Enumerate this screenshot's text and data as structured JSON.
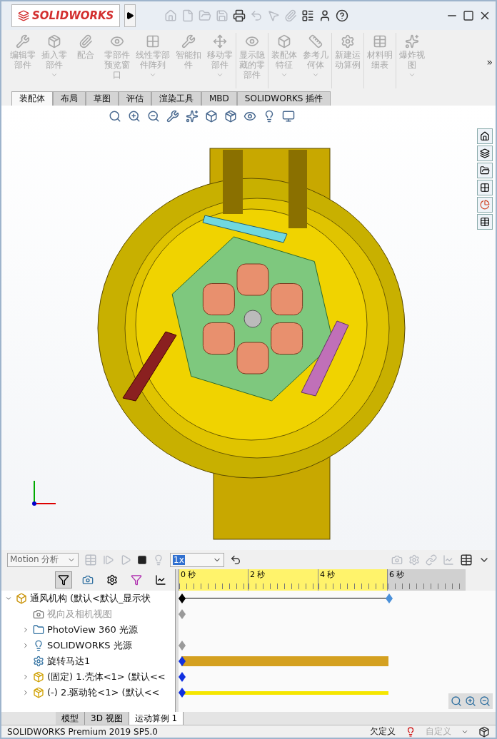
{
  "app": {
    "logo": "SOLIDWORKS"
  },
  "ribbon": {
    "buttons": [
      {
        "label": "编辑零部件",
        "disabled": true,
        "dropdown": false
      },
      {
        "label": "插入零部件",
        "disabled": true,
        "dropdown": true
      },
      {
        "label": "配合",
        "disabled": true,
        "dropdown": false
      },
      {
        "label": "零部件预览窗口",
        "disabled": true,
        "dropdown": false
      },
      {
        "label": "线性零部件阵列",
        "disabled": true,
        "dropdown": true
      },
      {
        "label": "智能扣件",
        "disabled": true,
        "dropdown": false
      },
      {
        "label": "移动零部件",
        "disabled": true,
        "dropdown": true
      },
      {
        "label": "显示隐藏的零部件",
        "disabled": true,
        "dropdown": false
      },
      {
        "label": "装配体特征",
        "disabled": true,
        "dropdown": true
      },
      {
        "label": "参考几何体",
        "disabled": true,
        "dropdown": true
      },
      {
        "label": "新建运动算例",
        "disabled": true,
        "dropdown": false
      },
      {
        "label": "材料明细表",
        "disabled": true,
        "dropdown": false
      },
      {
        "label": "爆炸视图",
        "disabled": true,
        "dropdown": true
      }
    ],
    "more": "»"
  },
  "tabs": [
    {
      "label": "装配体",
      "selected": true
    },
    {
      "label": "布局",
      "selected": false
    },
    {
      "label": "草图",
      "selected": false
    },
    {
      "label": "评估",
      "selected": false
    },
    {
      "label": "渲染工具",
      "selected": false
    },
    {
      "label": "MBD",
      "selected": false
    },
    {
      "label": "SOLIDWORKS 插件",
      "selected": false
    }
  ],
  "motion": {
    "study_type": "Motion 分析",
    "speed": "1x",
    "ruler": [
      "0 秒",
      "2 秒",
      "4 秒",
      "6 秒"
    ],
    "tree": [
      {
        "label": "通风机构",
        "suffix": "(默认<默认_显示状",
        "kind": "assembly",
        "expanded": true,
        "disabled": false,
        "track": {
          "kind": "line",
          "color": "#000000"
        },
        "children": [
          {
            "label": "视向及相机视图",
            "kind": "camera",
            "disabled": true,
            "track": {
              "kind": "key",
              "color": "#9a9a9a"
            }
          },
          {
            "label": "PhotoView 360 光源",
            "kind": "photo-lights",
            "expanded": false,
            "disabled": false
          },
          {
            "label": "SOLIDWORKS 光源",
            "kind": "lights",
            "expanded": false,
            "disabled": false,
            "track": {
              "kind": "key",
              "color": "#9a9a9a"
            }
          },
          {
            "label": "旋转马达1",
            "kind": "motor",
            "disabled": false,
            "track": {
              "kind": "bar",
              "color": "#d4a020"
            }
          },
          {
            "label": "(固定) 1.壳体<1> (默认<<",
            "kind": "part",
            "expanded": false,
            "disabled": false,
            "track": {
              "kind": "key",
              "color": "#1030e0"
            }
          },
          {
            "label": "(-) 2.驱动轮<1> (默认<<",
            "kind": "part",
            "expanded": false,
            "disabled": false,
            "track": {
              "kind": "thinbar",
              "color": "#f5e600"
            }
          }
        ]
      }
    ]
  },
  "bottom_tabs": [
    {
      "label": "模型",
      "selected": false
    },
    {
      "label": "3D 视图",
      "selected": false
    },
    {
      "label": "运动算例 1",
      "selected": true
    }
  ],
  "status_bar": {
    "product": "SOLIDWORKS Premium 2019 SP5.0",
    "state": "欠定义",
    "units": "自定义",
    "units_disabled": true
  }
}
